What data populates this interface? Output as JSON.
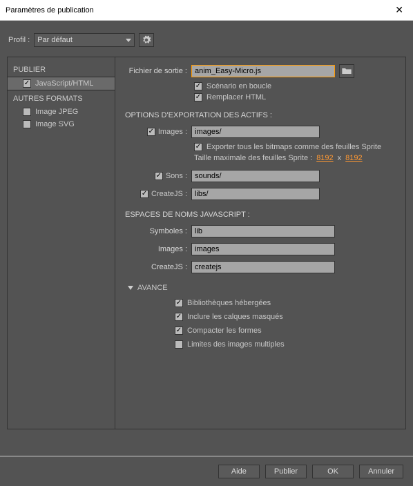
{
  "title": "Paramètres de publication",
  "profile": {
    "label": "Profil :",
    "value": "Par défaut"
  },
  "sidebar": {
    "heading_publish": "PUBLIER",
    "heading_other": "AUTRES FORMATS",
    "items": [
      {
        "label": "JavaScript/HTML",
        "checked": true,
        "selected": true
      },
      {
        "label": "Image JPEG",
        "checked": false,
        "selected": false
      },
      {
        "label": "Image SVG",
        "checked": false,
        "selected": false
      }
    ]
  },
  "output": {
    "label": "Fichier de sortie :",
    "value": "anim_Easy-Micro.js",
    "loop_label": "Scénario en boucle",
    "overwrite_label": "Remplacer HTML"
  },
  "export": {
    "heading": "OPTIONS D'EXPORTATION DES ACTIFS :",
    "images_label": "Images :",
    "images_path": "images/",
    "sprite_export_label": "Exporter tous les bitmaps comme des feuilles Sprite",
    "sprite_size_label": "Taille maximale des feuilles Sprite :",
    "sprite_w": "8192",
    "sprite_x": "x",
    "sprite_h": "8192",
    "sounds_label": "Sons :",
    "sounds_path": "sounds/",
    "createjs_label": "CreateJS :",
    "createjs_path": "libs/"
  },
  "ns": {
    "heading": "ESPACES DE NOMS JAVASCRIPT :",
    "symbols_label": "Symboles :",
    "symbols_val": "lib",
    "images_label": "Images :",
    "images_val": "images",
    "createjs_label": "CreateJS :",
    "createjs_val": "createjs"
  },
  "advanced": {
    "heading": "AVANCE",
    "hosted_label": "Bibliothèques hébergées",
    "hidden_label": "Inclure les calques masqués",
    "compact_label": "Compacter les formes",
    "multiframe_label": "Limites des images multiples"
  },
  "buttons": {
    "help": "Aide",
    "publish": "Publier",
    "ok": "OK",
    "cancel": "Annuler"
  }
}
